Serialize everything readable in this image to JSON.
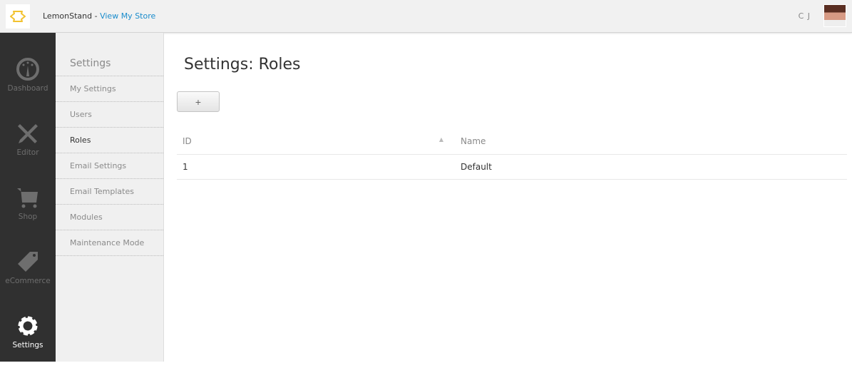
{
  "topbar": {
    "brand": "LemonStand",
    "separator": " - ",
    "store_link": "View My Store",
    "user_initials": "C J"
  },
  "nav": [
    {
      "label": "Dashboard",
      "icon": "gauge-icon"
    },
    {
      "label": "Editor",
      "icon": "tools-icon"
    },
    {
      "label": "Shop",
      "icon": "cart-icon"
    },
    {
      "label": "eCommerce",
      "icon": "tag-icon"
    },
    {
      "label": "Settings",
      "icon": "gear-icon",
      "active": true
    }
  ],
  "sidebar": {
    "title": "Settings",
    "items": [
      {
        "label": "My Settings"
      },
      {
        "label": "Users"
      },
      {
        "label": "Roles",
        "active": true
      },
      {
        "label": "Email Settings"
      },
      {
        "label": "Email Templates"
      },
      {
        "label": "Modules"
      },
      {
        "label": "Maintenance Mode"
      }
    ]
  },
  "main": {
    "title": "Settings: Roles",
    "add_label": "+",
    "columns": [
      "ID",
      "Name"
    ],
    "rows": [
      {
        "id": "1",
        "name": "Default"
      }
    ]
  },
  "colors": {
    "accent": "#1a8ccc",
    "logo": "#f2c230",
    "nav_bg": "#303030"
  }
}
